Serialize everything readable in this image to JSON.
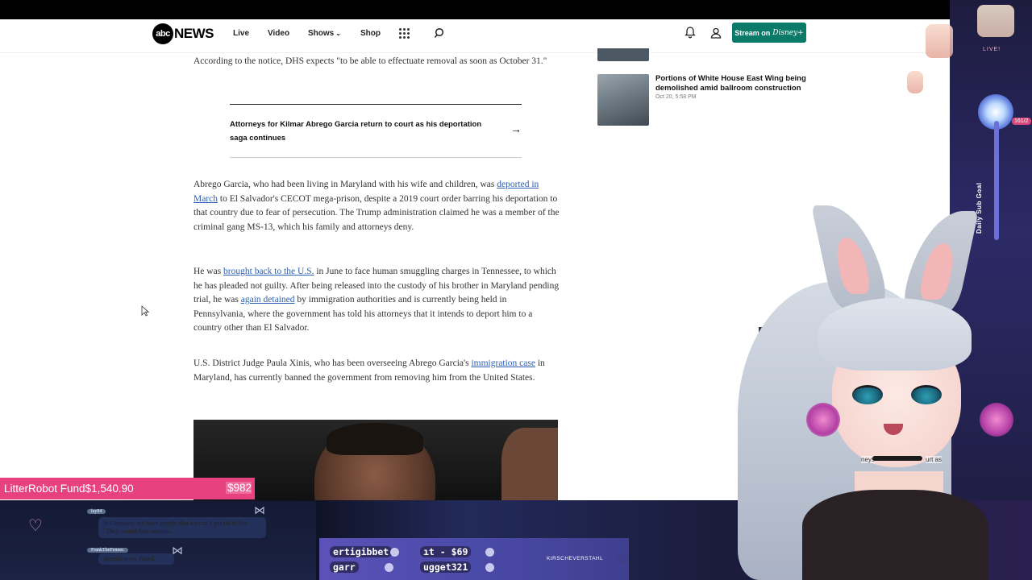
{
  "header": {
    "logo_mark": "abc",
    "logo_word": "NEWS",
    "nav": [
      "Live",
      "Video",
      "Shows",
      "Shop"
    ],
    "shows_chevron": "⌄",
    "stream_button": "Stream on",
    "stream_brand": "Disney+",
    "icons": [
      "grid-icon",
      "search-icon",
      "bell-icon",
      "user-icon"
    ]
  },
  "article": {
    "p1_a": "According to the notice, DHS expects \"to be able to effectuate removal as soon as October 31.\"",
    "related_title": "Attorneys for Kilmar Abrego Garcia return to court as his deportation saga continues",
    "related_arrow": "→",
    "p2_a": "Abrego Garcia, who had been living in Maryland with his wife and children, was ",
    "p2_link": "deported in March",
    "p2_b": " to El Salvador's CECOT mega-prison, despite a 2019 court order barring his deportation to that country due to fear of persecution. The Trump administration claimed he was a member of the criminal gang MS-13, which his family and attorneys deny.",
    "p3_a": "He was ",
    "p3_link1": "brought back to the U.S.",
    "p3_b": " in June to face human smuggling charges in Tennessee, to which he has pleaded not guilty. After being released into the custody of his brother in Maryland pending trial, he was ",
    "p3_link2": "again detained",
    "p3_c": " by immigration authorities and is currently being held in Pennsylvania, where the government has told his attorneys that it intends to deport him to a country other than El Salvador.",
    "p4_a": "U.S. District Judge Paula Xinis, who has been overseeing Abrego Garcia's ",
    "p4_link": "immigration case",
    "p4_b": " in Maryland, has currently banned the government from removing him from the United States."
  },
  "sidebar": {
    "story_title": "Portions of White House East Wing being demolished amid ballroom construction",
    "story_time": "Oct 20, 5:58 PM"
  },
  "stream_overlay": {
    "fund_label": "LitterRobot Fund$1,540.90",
    "fund_amount": "$982",
    "goal_label": "Daily Sub Goal",
    "goal_count": "161/2",
    "live_label": "LIVE!",
    "chat": [
      {
        "user": "lay84",
        "text": "In Germany, we have people that we can´t get rid of bcs \"They would face serious..."
      },
      {
        "user": "FrankTheFennec",
        "text": "@reallearycs Based"
      }
    ],
    "ticker": [
      "ertigibbet",
      "ıt - $69",
      "garr",
      "ugget321"
    ],
    "streamer_tag": "KIRSCHEVERSTAHL",
    "tv_text_left": "neys",
    "tv_text_right": "urt as"
  },
  "colors": {
    "accent_teal": "#0b7a68",
    "link_blue": "#2c5fb3",
    "fund_pink": "#e8417f"
  }
}
